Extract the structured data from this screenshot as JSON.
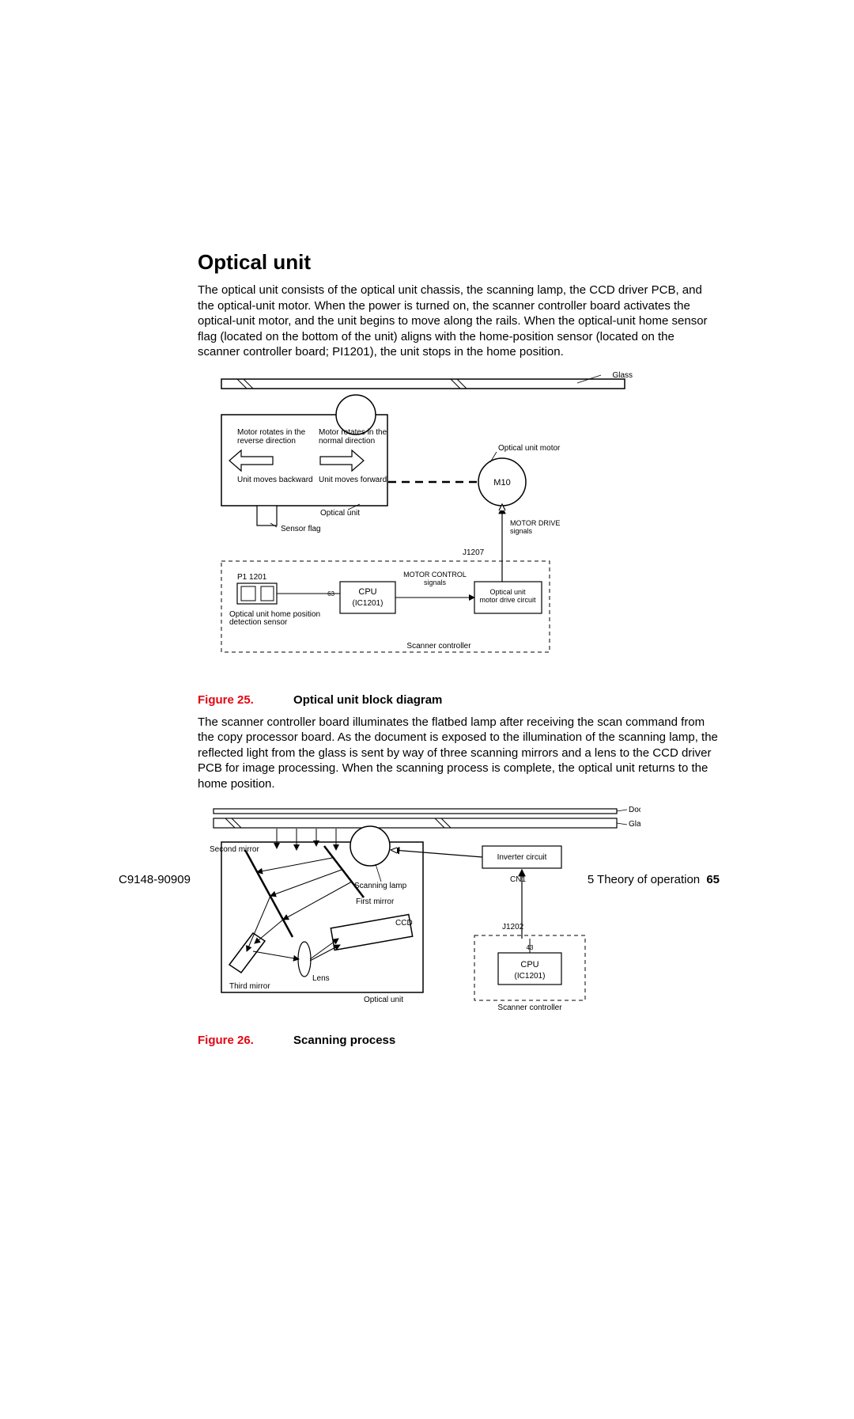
{
  "section_title": "Optical unit",
  "para1": "The optical unit consists of the optical unit chassis, the scanning lamp, the CCD driver PCB, and the optical-unit motor. When the power is turned on, the scanner controller board activates the optical-unit motor, and the unit begins to move along the rails. When the optical-unit home sensor flag (located on the bottom of the unit) aligns with the home-position sensor (located on the scanner controller board; PI1201), the unit stops in the home position.",
  "fig25_num": "Figure 25.",
  "fig25_title": "Optical unit block diagram",
  "para2": "The scanner controller board illuminates the flatbed lamp after receiving the scan command from the copy processor board. As the document is exposed to the illumination of the scanning lamp, the reflected light from the glass is sent by way of three scanning mirrors and a lens to the CCD driver PCB for image processing. When the scanning process is complete, the optical unit returns to the home position.",
  "fig26_num": "Figure 26.",
  "fig26_title": "Scanning process",
  "footer_left": "C9148-90909",
  "footer_right_chapter": "5 Theory of operation",
  "footer_right_page": "65",
  "d25": {
    "glass": "Glass",
    "motor_rev": "Motor rotates in the\nreverse direction",
    "motor_norm": "Motor rotates in the\nnormal direction",
    "unit_back": "Unit moves backward",
    "unit_forward": "Unit moves forward",
    "opt_unit": "Optical unit",
    "sensor_flag": "Sensor flag",
    "opt_unit_motor": "Optical unit motor",
    "m10": "M10",
    "motor_drive": "MOTOR DRIVE\nsignals",
    "j1207": "J1207",
    "pi1201": "P1 1201",
    "cpu": "CPU",
    "ic1201": "(IC1201)",
    "motor_control": "MOTOR CONTROL\nsignals",
    "opt_unit_mdc": "Optical unit\nmotor drive circuit",
    "home_sensor": "Optical unit home position\ndetection sensor",
    "scanner_ctrl": "Scanner controller",
    "pin63": "63"
  },
  "d26": {
    "document": "Document",
    "glass": "Glass",
    "second_mirror": "Second mirror",
    "scanning_lamp": "Scanning lamp",
    "first_mirror": "First mirror",
    "ccd": "CCD",
    "third_mirror": "Third mirror",
    "lens": "Lens",
    "optical_unit": "Optical unit",
    "inverter": "Inverter circuit",
    "cn1": "CN1",
    "j1202": "J1202",
    "cpu": "CPU",
    "ic1201": "(IC1201)",
    "pin43": "43",
    "scanner_ctrl": "Scanner controller"
  }
}
